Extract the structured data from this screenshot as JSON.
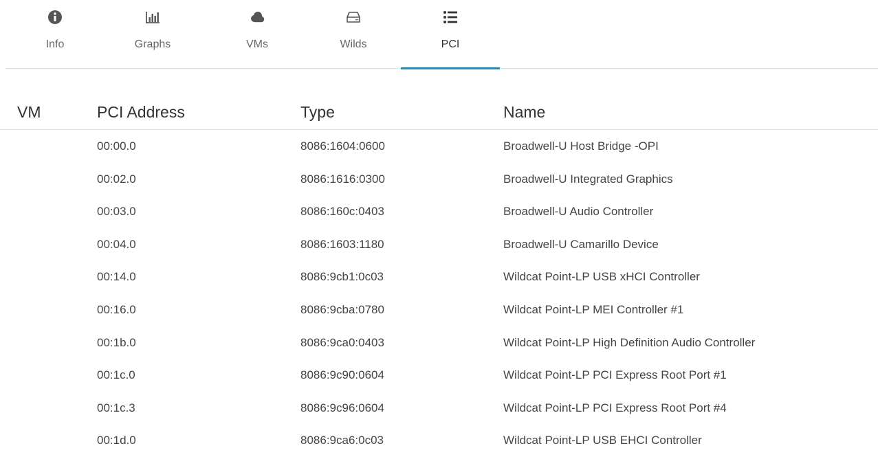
{
  "tabs": [
    {
      "label": "Info",
      "icon": "info-circle-icon",
      "active": false
    },
    {
      "label": "Graphs",
      "icon": "bar-chart-icon",
      "active": false
    },
    {
      "label": "VMs",
      "icon": "cloud-icon",
      "active": false
    },
    {
      "label": "Wilds",
      "icon": "hard-drive-icon",
      "active": false
    },
    {
      "label": "PCI",
      "icon": "list-icon",
      "active": true
    }
  ],
  "colors": {
    "accent": "#1f8fb5",
    "icon": "#555555"
  },
  "table": {
    "headers": {
      "vm": "VM",
      "address": "PCI Address",
      "type": "Type",
      "name": "Name"
    },
    "rows": [
      {
        "vm": "",
        "address": "00:00.0",
        "type": "8086:1604:0600",
        "name": "Broadwell-U Host Bridge -OPI"
      },
      {
        "vm": "",
        "address": "00:02.0",
        "type": "8086:1616:0300",
        "name": "Broadwell-U Integrated Graphics"
      },
      {
        "vm": "",
        "address": "00:03.0",
        "type": "8086:160c:0403",
        "name": "Broadwell-U Audio Controller"
      },
      {
        "vm": "",
        "address": "00:04.0",
        "type": "8086:1603:1180",
        "name": "Broadwell-U Camarillo Device"
      },
      {
        "vm": "",
        "address": "00:14.0",
        "type": "8086:9cb1:0c03",
        "name": "Wildcat Point-LP USB xHCI Controller"
      },
      {
        "vm": "",
        "address": "00:16.0",
        "type": "8086:9cba:0780",
        "name": "Wildcat Point-LP MEI Controller #1"
      },
      {
        "vm": "",
        "address": "00:1b.0",
        "type": "8086:9ca0:0403",
        "name": "Wildcat Point-LP High Definition Audio Controller"
      },
      {
        "vm": "",
        "address": "00:1c.0",
        "type": "8086:9c90:0604",
        "name": "Wildcat Point-LP PCI Express Root Port #1"
      },
      {
        "vm": "",
        "address": "00:1c.3",
        "type": "8086:9c96:0604",
        "name": "Wildcat Point-LP PCI Express Root Port #4"
      },
      {
        "vm": "",
        "address": "00:1d.0",
        "type": "8086:9ca6:0c03",
        "name": "Wildcat Point-LP USB EHCI Controller"
      }
    ]
  }
}
